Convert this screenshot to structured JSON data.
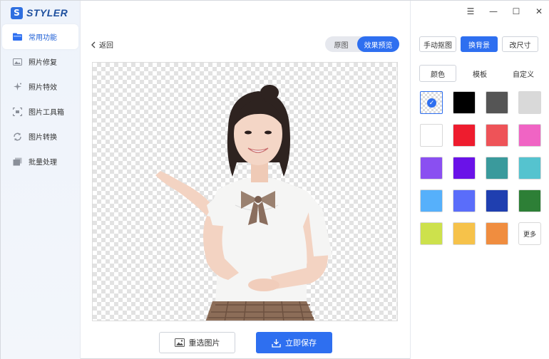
{
  "app": {
    "logo_letter": "S",
    "name": "STYLER"
  },
  "sidebar": {
    "items": [
      {
        "label": "常用功能",
        "icon": "folder-icon",
        "active": true
      },
      {
        "label": "照片修复",
        "icon": "photo-repair-icon",
        "active": false
      },
      {
        "label": "照片特效",
        "icon": "sparkle-icon",
        "active": false
      },
      {
        "label": "图片工具箱",
        "icon": "toolbox-icon",
        "active": false
      },
      {
        "label": "图片转换",
        "icon": "convert-icon",
        "active": false
      },
      {
        "label": "批量处理",
        "icon": "batch-icon",
        "active": false
      }
    ]
  },
  "main": {
    "back_label": "返回",
    "view_toggle": {
      "original": "原图",
      "preview": "效果预览",
      "selected": "效果预览"
    },
    "reselect_label": "重选图片",
    "save_label": "立即保存"
  },
  "window_controls": {
    "menu": "☰",
    "minimize": "—",
    "maximize": "☐",
    "close": "✕"
  },
  "panel": {
    "tools": [
      {
        "label": "手动抠图",
        "active": false
      },
      {
        "label": "换背景",
        "active": true
      },
      {
        "label": "改尺寸",
        "active": false
      }
    ],
    "subtabs": [
      {
        "label": "颜色",
        "active": true
      },
      {
        "label": "模板",
        "active": false
      },
      {
        "label": "自定义",
        "active": false
      }
    ],
    "colors": [
      "transparent",
      "#000000",
      "#555555",
      "#d9d9d9",
      "#ffffff",
      "#ee1c2e",
      "#ee5358",
      "#f064c4",
      "#8a4ff1",
      "#6a12e8",
      "#3a9a9c",
      "#55c3cf",
      "#56b0fb",
      "#5a6dfa",
      "#1f3fb0",
      "#2d7f36",
      "#cde14c",
      "#f6c24a",
      "#f08d3f"
    ],
    "selected_color": "transparent",
    "more_label": "更多"
  },
  "accent": "#2e6ff0"
}
